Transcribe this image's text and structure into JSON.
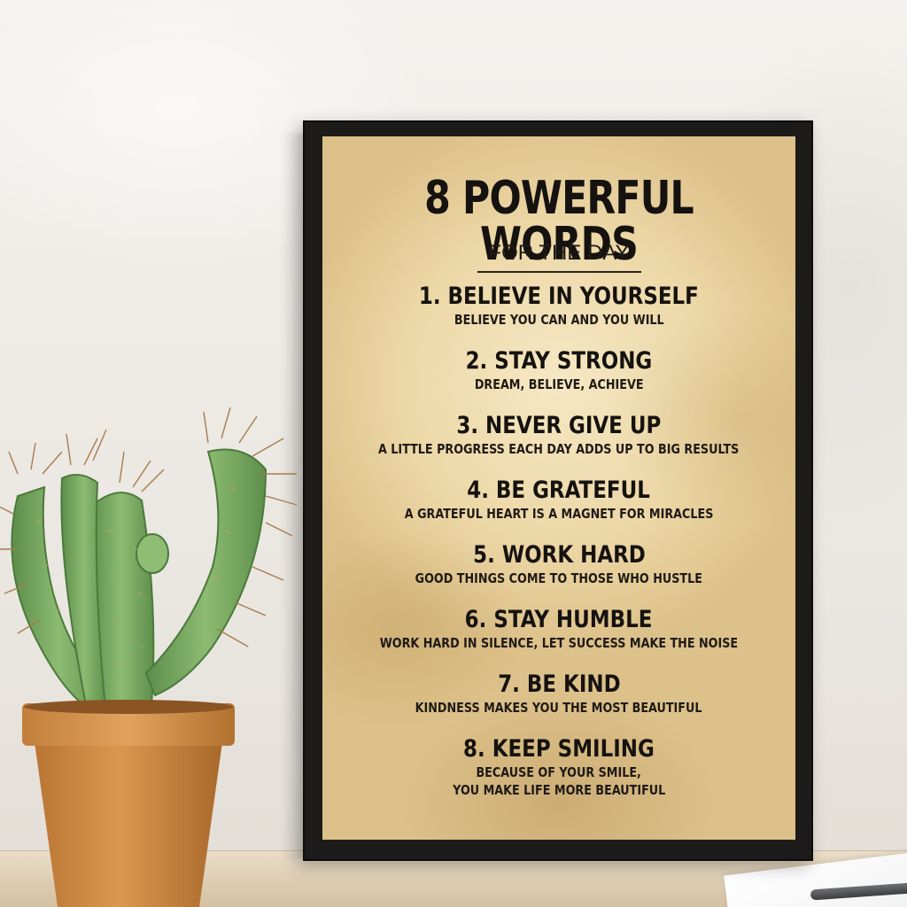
{
  "poster": {
    "title": "8 POWERFUL WORDS",
    "subtitle": "FOR THE DAY",
    "items": [
      {
        "heading": "1. BELIEVE IN YOURSELF",
        "lines": [
          "BELIEVE YOU CAN AND YOU WILL"
        ]
      },
      {
        "heading": "2. STAY STRONG",
        "lines": [
          "DREAM, BELIEVE, ACHIEVE"
        ]
      },
      {
        "heading": "3. NEVER GIVE UP",
        "lines": [
          "A LITTLE PROGRESS EACH DAY ADDS UP TO BIG RESULTS"
        ]
      },
      {
        "heading": "4. BE GRATEFUL",
        "lines": [
          "A GRATEFUL HEART IS A MAGNET FOR MIRACLES"
        ]
      },
      {
        "heading": "5. WORK HARD",
        "lines": [
          "GOOD THINGS COME TO THOSE WHO HUSTLE"
        ]
      },
      {
        "heading": "6. STAY HUMBLE",
        "lines": [
          "WORK HARD IN SILENCE, LET SUCCESS MAKE THE NOISE"
        ]
      },
      {
        "heading": "7. BE KIND",
        "lines": [
          "KINDNESS MAKES YOU THE MOST BEAUTIFUL"
        ]
      },
      {
        "heading": "8. KEEP SMILING",
        "lines": [
          "BECAUSE OF YOUR SMILE,",
          "YOU MAKE LIFE MORE BEAUTIFUL"
        ]
      }
    ]
  },
  "colors": {
    "frame": "#1d1b19",
    "parchment": "#ecd7a6",
    "ink": "#15120f",
    "cactus": "#7fae66",
    "pot": "#c98a42"
  }
}
